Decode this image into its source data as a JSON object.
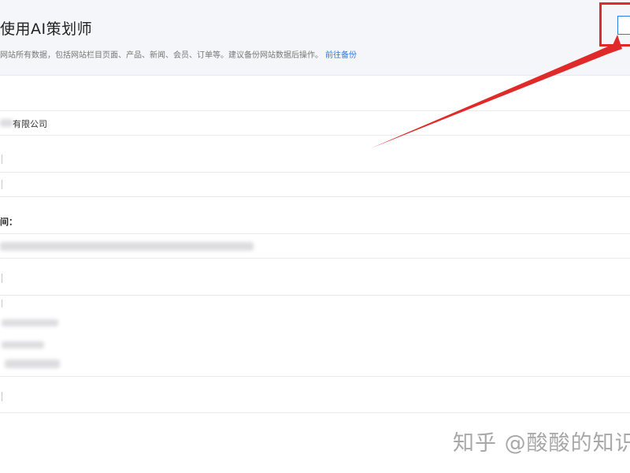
{
  "header": {
    "title": "使用AI策划师",
    "description": "网站所有数据，包括网站栏目页面、产品、新闻、会员、订单等。建议备份网站数据后操作。",
    "backup_link": "前往备份"
  },
  "form": {
    "company_name_value": "有限公司",
    "section_label": "间："
  },
  "watermark": {
    "text": "知乎 @酸酸的知识"
  },
  "colors": {
    "accent": "#2d7be5",
    "annotation": "#e02a2a",
    "header_bg": "#f4f6fa"
  }
}
